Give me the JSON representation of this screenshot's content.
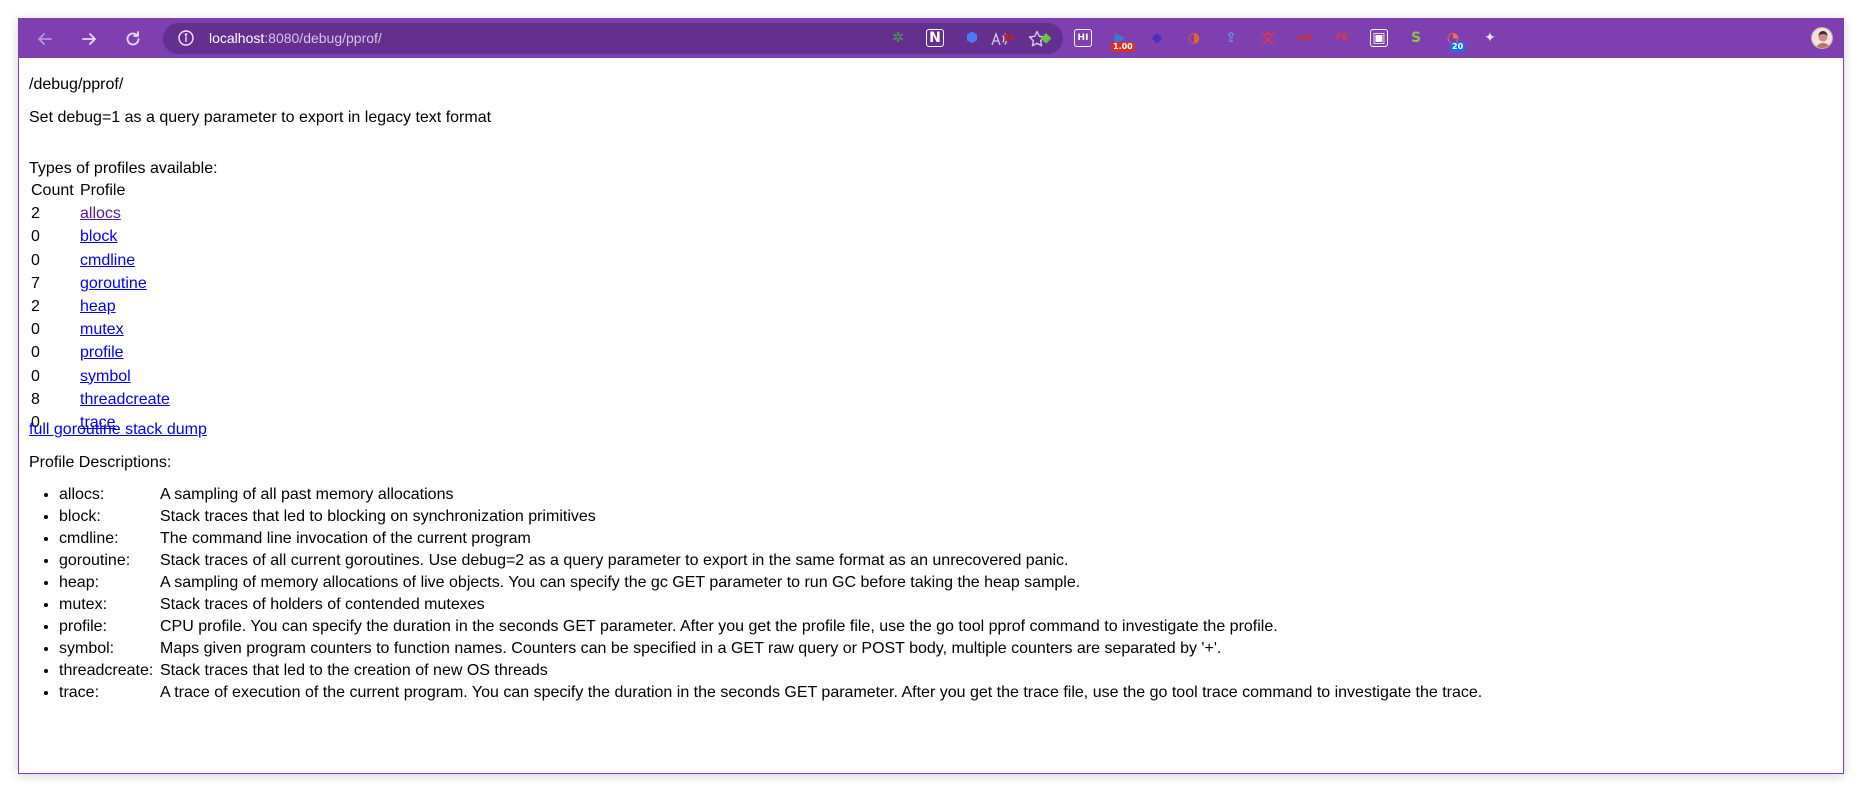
{
  "browser": {
    "url_host": "localhost",
    "url_rest": ":8080/debug/pprof/",
    "extensions": [
      {
        "icon": "puzzle-gear-icon",
        "color": "#3fa34d",
        "text": "✲",
        "badge": ""
      },
      {
        "icon": "notion-icon",
        "color": "#ffffff",
        "text": "N",
        "badge": ""
      },
      {
        "icon": "blue-link-icon",
        "color": "#4a7cf0",
        "text": "⬢",
        "badge": ""
      },
      {
        "icon": "pause-red-icon",
        "color": "#b8232a",
        "text": "▮▮",
        "badge": ""
      },
      {
        "icon": "leaf-icon",
        "color": "#6bbf3a",
        "text": "◆",
        "badge": ""
      },
      {
        "icon": "hi-icon",
        "color": "#ffffff",
        "text": "HI",
        "badge": ""
      },
      {
        "icon": "speed-icon",
        "color": "#3b78d8",
        "text": "▶",
        "badge": "1.00"
      },
      {
        "icon": "layers-icon",
        "color": "#4b2fbf",
        "text": "◆",
        "badge": ""
      },
      {
        "icon": "half-circle-icon",
        "color": "#e0662a",
        "text": "◑",
        "badge": ""
      },
      {
        "icon": "upload-icon",
        "color": "#5a9bd5",
        "text": "⇪",
        "badge": ""
      },
      {
        "icon": "translate-icon",
        "color": "#d6365a",
        "text": "文",
        "badge": ""
      },
      {
        "icon": "adblock-icon",
        "color": "#d32f2f",
        "text": "ABP",
        "badge": ""
      },
      {
        "icon": "fe-icon",
        "color": "#e53935",
        "text": "FE",
        "badge": ""
      },
      {
        "icon": "window-icon",
        "color": "#ffffff",
        "text": "▣",
        "badge": ""
      },
      {
        "icon": "lemon-icon",
        "color": "#8bc34a",
        "text": "S",
        "badge": ""
      },
      {
        "icon": "timer-icon",
        "color": "#ff7043",
        "text": "◔",
        "badge": "20"
      },
      {
        "icon": "extensions-puzzle-icon",
        "color": "#e9dcf5",
        "text": "✦",
        "badge": ""
      }
    ]
  },
  "page": {
    "path": "/debug/pprof/",
    "hint": "Set debug=1 as a query parameter to export in legacy text format",
    "types_title": "Types of profiles available:",
    "table_headers": {
      "count": "Count",
      "profile": "Profile"
    },
    "profiles": [
      {
        "count": "2",
        "name": "allocs"
      },
      {
        "count": "0",
        "name": "block"
      },
      {
        "count": "0",
        "name": "cmdline"
      },
      {
        "count": "7",
        "name": "goroutine"
      },
      {
        "count": "2",
        "name": "heap"
      },
      {
        "count": "0",
        "name": "mutex"
      },
      {
        "count": "0",
        "name": "profile"
      },
      {
        "count": "0",
        "name": "symbol"
      },
      {
        "count": "8",
        "name": "threadcreate"
      },
      {
        "count": "0",
        "name": "trace"
      }
    ],
    "full_dump": "full goroutine stack dump",
    "desc_title": "Profile Descriptions:",
    "descriptions": [
      {
        "name": "allocs:",
        "text": "A sampling of all past memory allocations"
      },
      {
        "name": "block:",
        "text": "Stack traces that led to blocking on synchronization primitives"
      },
      {
        "name": "cmdline:",
        "text": "The command line invocation of the current program"
      },
      {
        "name": "goroutine:",
        "text": "Stack traces of all current goroutines. Use debug=2 as a query parameter to export in the same format as an unrecovered panic."
      },
      {
        "name": "heap:",
        "text": "A sampling of memory allocations of live objects. You can specify the gc GET parameter to run GC before taking the heap sample."
      },
      {
        "name": "mutex:",
        "text": "Stack traces of holders of contended mutexes"
      },
      {
        "name": "profile:",
        "text": "CPU profile. You can specify the duration in the seconds GET parameter. After you get the profile file, use the go tool pprof command to investigate the profile."
      },
      {
        "name": "symbol:",
        "text": "Maps given program counters to function names. Counters can be specified in a GET raw query or POST body, multiple counters are separated by '+'."
      },
      {
        "name": "threadcreate:",
        "text": "Stack traces that led to the creation of new OS threads"
      },
      {
        "name": "trace:",
        "text": "A trace of execution of the current program. You can specify the duration in the seconds GET parameter. After you get the trace file, use the go tool trace command to investigate the trace."
      }
    ]
  },
  "colors": {
    "toolbar": "#7e3fb1",
    "omnibox": "#63308f",
    "link": "#0000ee",
    "visited_link": "#551a8b"
  }
}
